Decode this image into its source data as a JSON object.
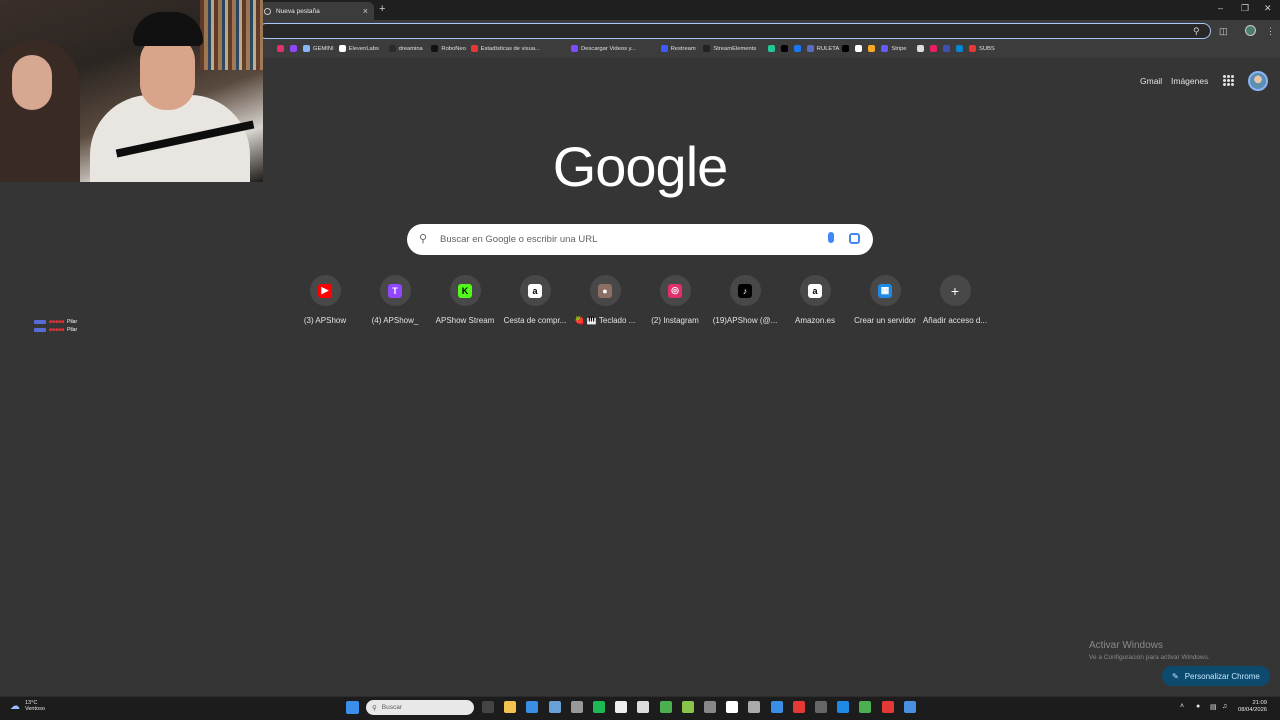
{
  "browser": {
    "tab_title": "Nueva pestaña",
    "new_tab_label": "+",
    "close_tab_label": "×",
    "window_controls": [
      "–",
      "❐",
      "✕"
    ]
  },
  "bookmarks": [
    {
      "label": "",
      "color": "#e1306c"
    },
    {
      "label": "",
      "color": "#9146ff"
    },
    {
      "label": "GEMINI",
      "color": "#8ab4f8"
    },
    {
      "label": "ElevenLabs",
      "color": "#ffffff"
    },
    {
      "label": "dreamina",
      "color": "#2b2b2b"
    },
    {
      "label": "RoboNeo",
      "color": "#111111"
    },
    {
      "label": "Estadísticas de visua...",
      "color": "#e53935"
    },
    {
      "label": "Descargar Videos y...",
      "color": "#7c4dff"
    },
    {
      "label": "Restream",
      "color": "#3d5afe"
    },
    {
      "label": "StreamElements",
      "color": "#222222"
    },
    {
      "label": "",
      "color": "#20c997"
    },
    {
      "label": "",
      "color": "#000000"
    },
    {
      "label": "",
      "color": "#1877f2"
    },
    {
      "label": "RULETA",
      "color": "#5c6bc0"
    },
    {
      "label": "",
      "color": "#000000"
    },
    {
      "label": "",
      "color": "#ffffff"
    },
    {
      "label": "",
      "color": "#f9a825"
    },
    {
      "label": "Stripe",
      "color": "#635bff"
    },
    {
      "label": "",
      "color": "#dddddd"
    },
    {
      "label": "",
      "color": "#e91e63"
    },
    {
      "label": "",
      "color": "#3f51b5"
    },
    {
      "label": "",
      "color": "#0288d1"
    },
    {
      "label": "SUBS",
      "color": "#e53935"
    }
  ],
  "overlay": {
    "rows": [
      {
        "name": "Pilar"
      },
      {
        "name": "Pilar"
      }
    ]
  },
  "google": {
    "gmail": "Gmail",
    "images": "Imágenes",
    "logo": "Google",
    "search_placeholder": "Buscar en Google o escribir una URL"
  },
  "shortcuts": [
    {
      "title": "(3) APShow",
      "icon": "youtube-icon",
      "glyph": "▶",
      "color": "#ff0000"
    },
    {
      "title": "(4) APShow_",
      "icon": "twitch-icon",
      "glyph": "T",
      "color": "#9146ff"
    },
    {
      "title": "APShow Stream",
      "icon": "kick-icon",
      "glyph": "K",
      "color": "#53fc18"
    },
    {
      "title": "Cesta de compr...",
      "icon": "amazon-icon",
      "glyph": "a",
      "color": "#ffffff"
    },
    {
      "title": "🍓 🎹 Teclado ...",
      "icon": "product-icon",
      "glyph": "●",
      "color": "#8d6e63"
    },
    {
      "title": "(2) Instagram",
      "icon": "instagram-icon",
      "glyph": "◎",
      "color": "#e1306c"
    },
    {
      "title": "(19)APShow (@...",
      "icon": "tiktok-icon",
      "glyph": "♪",
      "color": "#000000"
    },
    {
      "title": "Amazon.es",
      "icon": "amazon-icon",
      "glyph": "a",
      "color": "#ffffff"
    },
    {
      "title": "Crear un servidor",
      "icon": "server-icon",
      "glyph": "▦",
      "color": "#1e88e5"
    },
    {
      "title": "Añadir acceso d...",
      "icon": "add-icon",
      "glyph": "+",
      "color": "#484848"
    }
  ],
  "watermark": {
    "title": "Activar Windows",
    "subtitle": "Ve a Configuración para activar Windows."
  },
  "customize_label": "Personalizar Chrome",
  "taskbar": {
    "weather_temp": "13°C",
    "weather_desc": "Ventoso",
    "search_placeholder": "Buscar",
    "time": "21:09",
    "date": "08/04/2026"
  }
}
